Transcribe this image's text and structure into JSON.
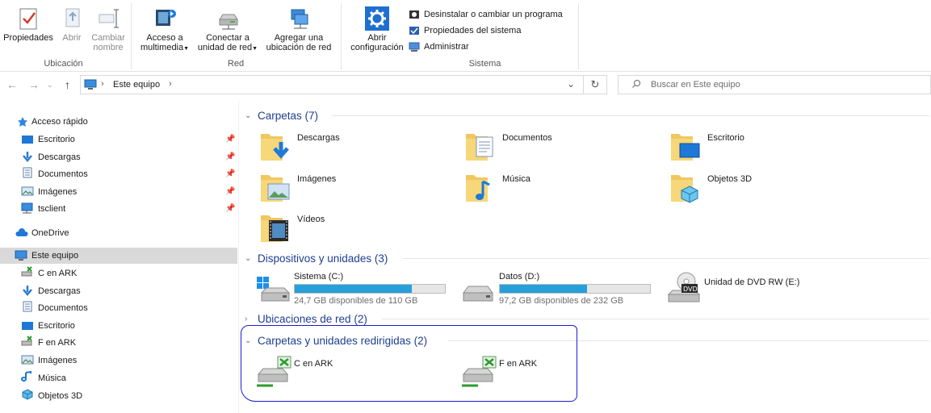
{
  "ribbon": {
    "ubicacion": {
      "label": "Ubicación",
      "propiedades": "Propiedades",
      "abrir": "Abrir",
      "cambiar": "Cambiar",
      "nombre": "nombre"
    },
    "red": {
      "label": "Red",
      "acceso_line1": "Acceso a",
      "acceso_line2": "multimedia",
      "conectar_line1": "Conectar a",
      "conectar_line2": "unidad de red",
      "agregar_line1": "Agregar una",
      "agregar_line2": "ubicación de red"
    },
    "sistema": {
      "label": "Sistema",
      "abrir_line1": "Abrir",
      "abrir_line2": "configuración",
      "desinstalar": "Desinstalar o cambiar un programa",
      "propiedades_sistema": "Propiedades del sistema",
      "administrar": "Administrar"
    }
  },
  "address": {
    "path": "Este equipo",
    "search_placeholder": "Buscar en Este equipo"
  },
  "nav": {
    "acceso_rapido": "Acceso rápido",
    "quick": [
      "Escritorio",
      "Descargas",
      "Documentos",
      "Imágenes",
      "tsclient"
    ],
    "onedrive": "OneDrive",
    "este_equipo": "Este equipo",
    "equipo": [
      "C en ARK",
      "Descargas",
      "Documentos",
      "Escritorio",
      "F en ARK",
      "Imágenes",
      "Música",
      "Objetos 3D"
    ]
  },
  "content": {
    "carpetas": {
      "title": "Carpetas (7)",
      "items": [
        "Descargas",
        "Documentos",
        "Escritorio",
        "Imágenes",
        "Música",
        "Objetos 3D",
        "Vídeos"
      ]
    },
    "dispositivos": {
      "title": "Dispositivos y unidades (3)",
      "drives": [
        {
          "name": "Sistema (C:)",
          "free": "24,7 GB disponibles de 110 GB",
          "used_fraction": 0.78
        },
        {
          "name": "Datos (D:)",
          "free": "97,2 GB disponibles de 232 GB",
          "used_fraction": 0.58
        }
      ],
      "dvd": "Unidad de DVD RW (E:)"
    },
    "ubicaciones": {
      "title": "Ubicaciones de red (2)"
    },
    "redirigidas": {
      "title": "Carpetas y unidades redirigidas (2)",
      "items": [
        "C en ARK",
        "F en ARK"
      ]
    }
  },
  "colors": {
    "accent": "#26a0da",
    "section_header": "#1e3e8f",
    "annotation": "#1b1bd1"
  }
}
